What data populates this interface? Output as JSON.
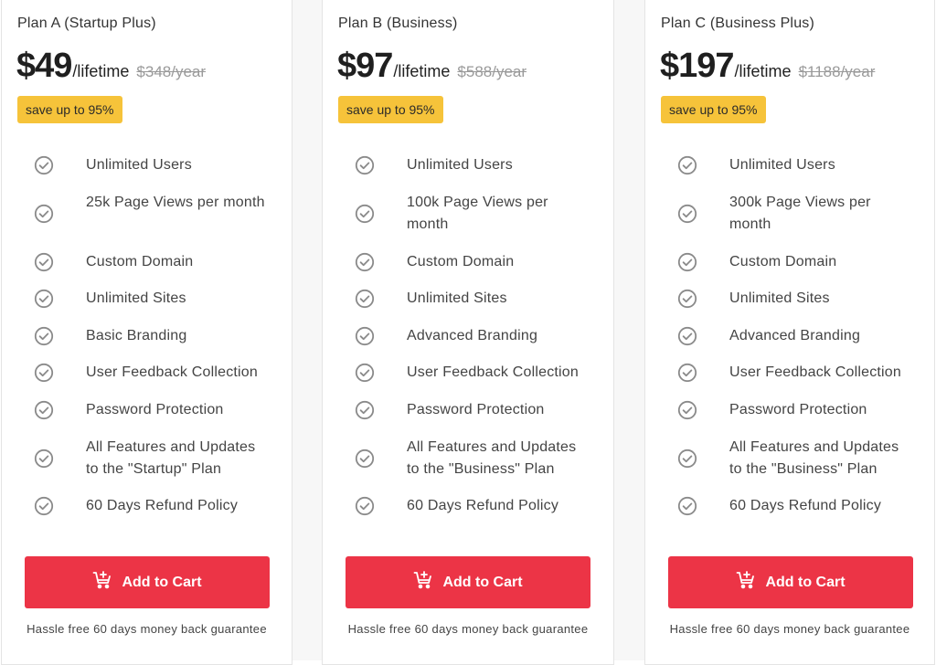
{
  "plans": [
    {
      "name": "Plan A (Startup Plus)",
      "price": "$49",
      "period": "/lifetime",
      "original_price": "$348/year",
      "badge": "save up to 95%",
      "features": [
        "Unlimited Users",
        "25k Page Views per month",
        "Custom Domain",
        "Unlimited Sites",
        "Basic Branding",
        "User Feedback Collection",
        "Password Protection",
        "All Features and Updates to the \"Startup\" Plan",
        "60 Days Refund Policy"
      ],
      "button_label": "Add to Cart",
      "guarantee": "Hassle free 60 days money back guarantee"
    },
    {
      "name": "Plan B (Business)",
      "price": "$97",
      "period": "/lifetime",
      "original_price": "$588/year",
      "badge": "save up to 95%",
      "features": [
        "Unlimited Users",
        "100k Page Views per month",
        "Custom Domain",
        "Unlimited Sites",
        "Advanced Branding",
        "User Feedback Collection",
        "Password Protection",
        "All Features and Updates to the \"Business\" Plan",
        "60 Days Refund Policy"
      ],
      "button_label": "Add to Cart",
      "guarantee": "Hassle free 60 days money back guarantee"
    },
    {
      "name": "Plan C (Business Plus)",
      "price": "$197",
      "period": "/lifetime",
      "original_price": "$1188/year",
      "badge": "save up to 95%",
      "features": [
        "Unlimited Users",
        "300k Page Views per month",
        "Custom Domain",
        "Unlimited Sites",
        "Advanced Branding",
        "User Feedback Collection",
        "Password Protection",
        "All Features and Updates to the \"Business\" Plan",
        "60 Days Refund Policy"
      ],
      "button_label": "Add to Cart",
      "guarantee": "Hassle free 60 days money back guarantee"
    }
  ],
  "colors": {
    "button": "#ec3446",
    "badge": "#f6c33a",
    "check": "#8a8a8a"
  },
  "icons": {
    "feature": "check-circle-icon",
    "button": "cart-plus-icon"
  }
}
